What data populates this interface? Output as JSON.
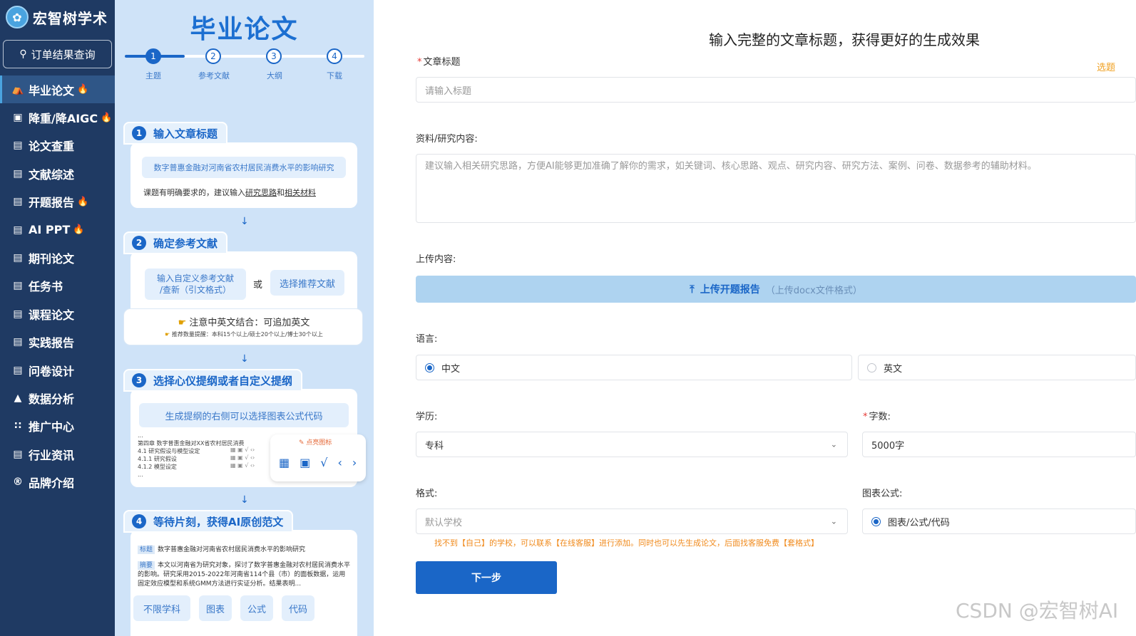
{
  "brand": {
    "name": "宏智树学术",
    "logo_icon": "tree-icon"
  },
  "order_search": {
    "label": "订单结果查询",
    "icon": "search-icon"
  },
  "nav": {
    "items": [
      {
        "label": "毕业论文",
        "icon": "graduation-cap-icon",
        "hot": true,
        "active": true
      },
      {
        "label": "降重/降AIGC",
        "icon": "bus-icon",
        "hot": true
      },
      {
        "label": "论文查重",
        "icon": "document-check-icon",
        "hot": false
      },
      {
        "label": "文献综述",
        "icon": "list-icon",
        "hot": false
      },
      {
        "label": "开题报告",
        "icon": "report-icon",
        "hot": true
      },
      {
        "label": "AI PPT",
        "icon": "ppt-icon",
        "hot": true
      },
      {
        "label": "期刊论文",
        "icon": "journal-icon",
        "hot": false
      },
      {
        "label": "任务书",
        "icon": "book-icon",
        "hot": false
      },
      {
        "label": "课程论文",
        "icon": "course-icon",
        "hot": false
      },
      {
        "label": "实践报告",
        "icon": "practice-icon",
        "hot": false
      },
      {
        "label": "问卷设计",
        "icon": "survey-icon",
        "hot": false
      },
      {
        "label": "数据分析",
        "icon": "chart-icon",
        "hot": false
      },
      {
        "label": "推广中心",
        "icon": "grid-icon",
        "hot": false
      },
      {
        "label": "行业资讯",
        "icon": "news-icon",
        "hot": false
      },
      {
        "label": "品牌介绍",
        "icon": "registered-icon",
        "hot": false
      }
    ],
    "hot_glyph": "🔥"
  },
  "guide": {
    "title": "毕业论文",
    "steps": [
      {
        "num": "1",
        "label": "主题"
      },
      {
        "num": "2",
        "label": "参考文献"
      },
      {
        "num": "3",
        "label": "大纲"
      },
      {
        "num": "4",
        "label": "下载"
      }
    ],
    "card1": {
      "num": "1",
      "title": "输入文章标题",
      "example": "数字普惠金融对河南省农村居民消费水平的影响研究",
      "note_prefix": "课题有明确要求的，建议输入",
      "note_link1": "研究思路",
      "note_and": "和",
      "note_link2": "相关材料"
    },
    "card2": {
      "num": "2",
      "title": "确定参考文献",
      "custom": "输入自定义参考文献\n/查新（引文格式）",
      "or": "或",
      "recommend": "选择推荐文献",
      "tip": "注意中英文结合：可追加英文",
      "tip_small": "推荐数量提醒：本科15个以上/硕士20个以上/博士30个以上"
    },
    "card3": {
      "num": "3",
      "title": "选择心仪提纲或者自定义提纲",
      "chip": "生成提纲的右侧可以选择图表公式代码",
      "outline": [
        "...",
        "第四章 数字普惠金融对XX省农村居民消费",
        "4.1 研究假设与模型设定",
        "4.1.1 研究假设",
        "4.1.2 模型设定",
        "..."
      ],
      "popup_label": "点亮图标"
    },
    "card4": {
      "num": "4",
      "title": "等待片刻，获得AI原创范文",
      "tag_title": "标题",
      "title_text": "数字普惠金融对河南省农村居民消费水平的影响研究",
      "tag_abstract": "摘要",
      "abstract_text": "本文以河南省为研究对象，探讨了数字普惠金融对农村居民消费水平的影响。研究采用2015-2022年河南省114个县（市）的面板数据，运用固定效应模型和系统GMM方法进行实证分析。结果表明...",
      "tags": [
        "不限学科",
        "图表",
        "公式",
        "代码"
      ]
    }
  },
  "form": {
    "heading": "输入完整的文章标题，获得更好的生成效果",
    "title_label": "文章标题",
    "title_placeholder": "请输入标题",
    "topic_link": "选题",
    "material_label": "资料/研究内容:",
    "material_placeholder": "建议输入相关研究思路，方便AI能够更加准确了解你的需求，如关键词、核心思路、观点、研究内容、研究方法、案例、问卷、数据参考的辅助材料。",
    "upload_label": "上传内容:",
    "upload_button": "上传开题报告",
    "upload_sub": "（上传docx文件格式）",
    "language_label": "语言:",
    "lang_zh": "中文",
    "lang_en": "英文",
    "selected_language": "中文",
    "degree_label": "学历:",
    "degree_value": "专科",
    "words_label": "字数:",
    "words_value": "5000字",
    "format_label": "格式:",
    "format_placeholder": "默认学校",
    "chart_label": "图表公式:",
    "chart_option": "图表/公式/代码",
    "hint": "找不到【自己】的学校，可以联系【在线客服】进行添加。同时也可以先生成论文，后面找客服免费【套格式】",
    "next_button": "下一步"
  },
  "watermark": "CSDN @宏智树AI"
}
